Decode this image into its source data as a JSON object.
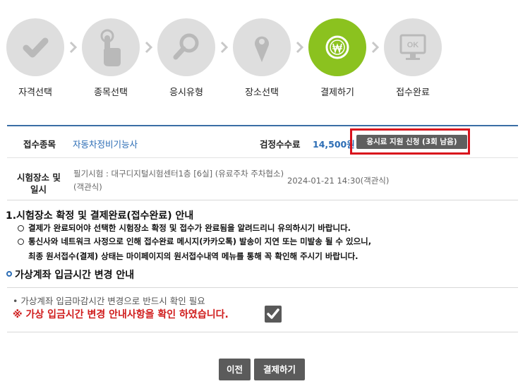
{
  "steps": [
    {
      "label": "자격선택",
      "icon": "check-icon",
      "active": false
    },
    {
      "label": "종목선택",
      "icon": "pointer-hand-icon",
      "active": false
    },
    {
      "label": "응시유형",
      "icon": "magnifier-icon",
      "active": false
    },
    {
      "label": "장소선택",
      "icon": "map-pin-icon",
      "active": false
    },
    {
      "label": "결제하기",
      "icon": "won-coin-icon",
      "active": true
    },
    {
      "label": "접수완료",
      "icon": "monitor-ok-icon",
      "active": false
    }
  ],
  "monitor_text": "OK",
  "info": {
    "exam_type_label": "접수종목",
    "exam_type_value": "자동차정비기능사",
    "fee_label": "검정수수료",
    "fee_value": "14,500원",
    "fee_support_button": "응시료 지원 신청 (3회 남음)",
    "place_label_line1": "시험장소 및",
    "place_label_line2": "일시",
    "place_value": "필기시험 : 대구디지털시험센터1층 [6실] (유료주차 주차협소)(객관식)",
    "datetime_value": "2024-01-21 14:30(객관식)"
  },
  "notice": {
    "title": "1.시험장소 확정 및 결제완료(접수완료) 안내",
    "item1": "결제가 완료되어야 선택한 시험장소 확정 및 접수가 완료됨을 알려드리니 유의하시기 바랍니다.",
    "item2_line1": "통신사와 네트워크 사정으로 인해 접수완료 메시지(카카오톡) 발송이 지연 또는 미발송 될 수 있으니,",
    "item2_line2": "최종 원서접수(결제) 상태는 마이페이지의 원서접수내역 메뉴를 통해 꼭 확인해 주시기 바랍니다."
  },
  "virtual_account": {
    "title": "가상계좌 입금시간 변경 안내",
    "line1": "• 가상계좌 입금마감시간 변경으로 반드시 확인 필요",
    "line2": "※ 가상 입금시간 변경 안내사항을 확인 하였습니다.",
    "confirmed": true
  },
  "buttons": {
    "prev": "이전",
    "pay": "결제하기"
  },
  "colors": {
    "active_step": "#8bc21f",
    "inactive_step": "#dedede",
    "accent_blue": "#2c6db5",
    "highlight_red": "#d9111c"
  }
}
